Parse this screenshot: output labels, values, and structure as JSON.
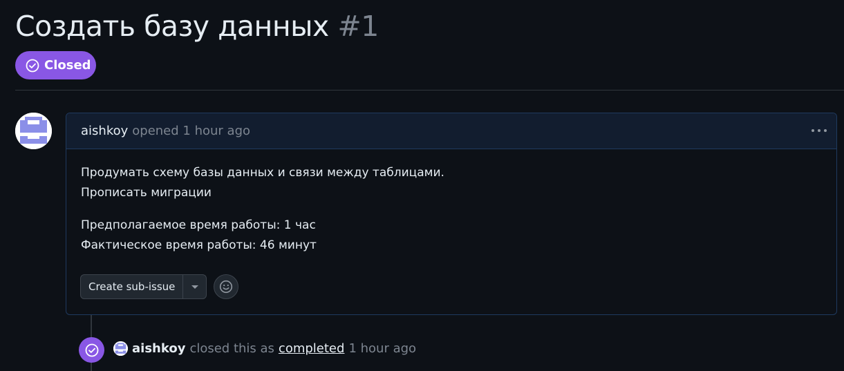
{
  "issue": {
    "title": "Создать базу данных",
    "number": "#1",
    "state": "Closed",
    "state_color": "#8957e5"
  },
  "comment": {
    "author": "aishkoy",
    "meta": "opened 1 hour ago",
    "body_lines_1": [
      "Продумать схему базы данных и связи между таблицами.",
      "Прописать миграции"
    ],
    "body_lines_2": [
      "Предполагаемое время работы: 1 час",
      "Фактическое время работы: 46 минут"
    ],
    "actions": {
      "create_sub_issue": "Create sub-issue"
    },
    "icons": {
      "more": "kebab-horizontal-icon",
      "reaction": "smiley-icon"
    }
  },
  "timeline_event": {
    "actor": "aishkoy",
    "action_text": "closed this as",
    "link_text": "completed",
    "time": "1 hour ago",
    "icon": "check-circle-icon"
  },
  "colors": {
    "background": "#0d1117",
    "closed_purple": "#8957e5",
    "muted_text": "#7d8590",
    "avatar_identicon": "#8b8fe8"
  }
}
